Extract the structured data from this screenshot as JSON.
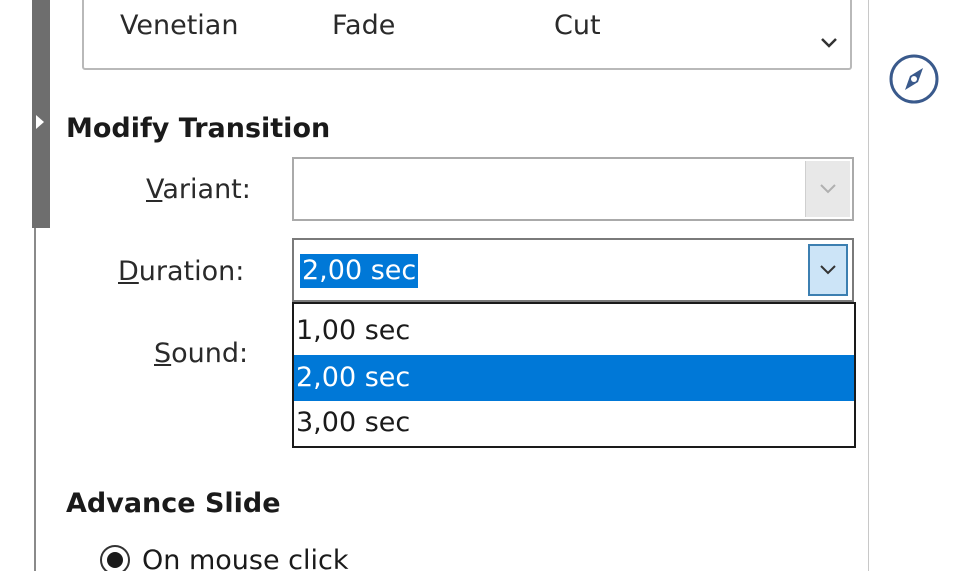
{
  "transitions": {
    "items": [
      "Venetian",
      "Fade",
      "Cut"
    ]
  },
  "modify": {
    "title": "Modify Transition",
    "variant_label_hotkey": "V",
    "variant_label_rest": "ariant:",
    "variant_value": "",
    "duration_label_hotkey": "D",
    "duration_label_rest": "uration:",
    "duration_value": "2,00 sec",
    "sound_label_hotkey": "S",
    "sound_label_rest": "ound:",
    "duration_options": [
      "1,00 sec",
      "2,00 sec",
      "3,00 sec"
    ],
    "selected_option": "2,00 sec"
  },
  "advance": {
    "title": "Advance Slide",
    "radio_label": "On mouse click",
    "radio_checked": true
  },
  "icons": {
    "navigator": "compass-icon",
    "box_dropdown": "chevron-down-icon",
    "splitter": "triangle-right-icon"
  },
  "colors": {
    "selection": "#0078d7",
    "focused_button": "#cce4f7",
    "splitter_bar": "#6e6e6e"
  }
}
